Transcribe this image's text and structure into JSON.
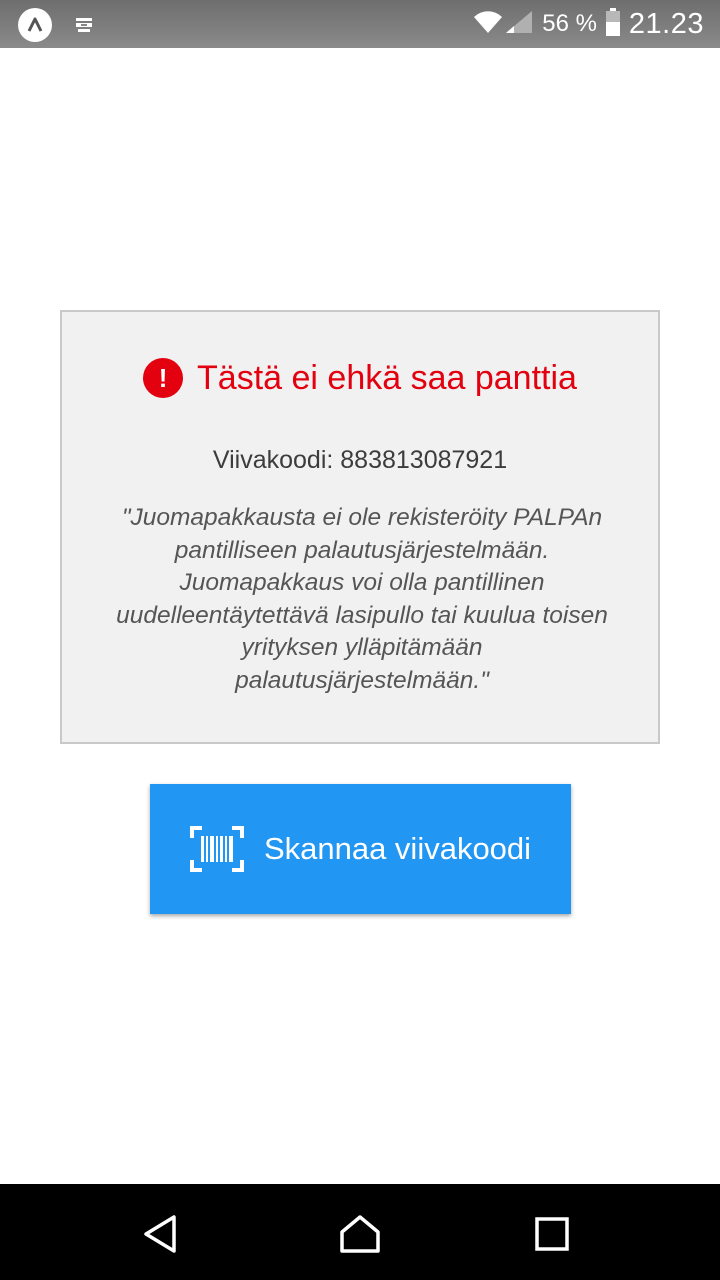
{
  "status_bar": {
    "battery_text": "56 %",
    "time": "21.23",
    "icons": [
      "app-launcher-icon",
      "notification-icon",
      "wifi-icon",
      "signal-icon",
      "battery-icon"
    ]
  },
  "warning": {
    "icon": "exclamation-icon",
    "icon_glyph": "!",
    "title": "Tästä ei ehkä saa panttia",
    "barcode_line": "Viivakoodi: 883813087921",
    "message": "\"Juomapakkausta ei ole rekisteröity PALPAn pantilliseen palautusjärjestelmään. Juomapakkaus voi olla pantillinen uudelleentäytettävä lasipullo tai kuulua toisen yrityksen ylläpitämään palautusjärjestelmään.\"",
    "color": "#e3000f"
  },
  "scan_button": {
    "icon": "barcode-scan-icon",
    "label": "Skannaa viivakoodi",
    "color": "#2196f3"
  },
  "nav_bar": {
    "icons": [
      "back-icon",
      "home-icon",
      "recents-icon"
    ]
  }
}
